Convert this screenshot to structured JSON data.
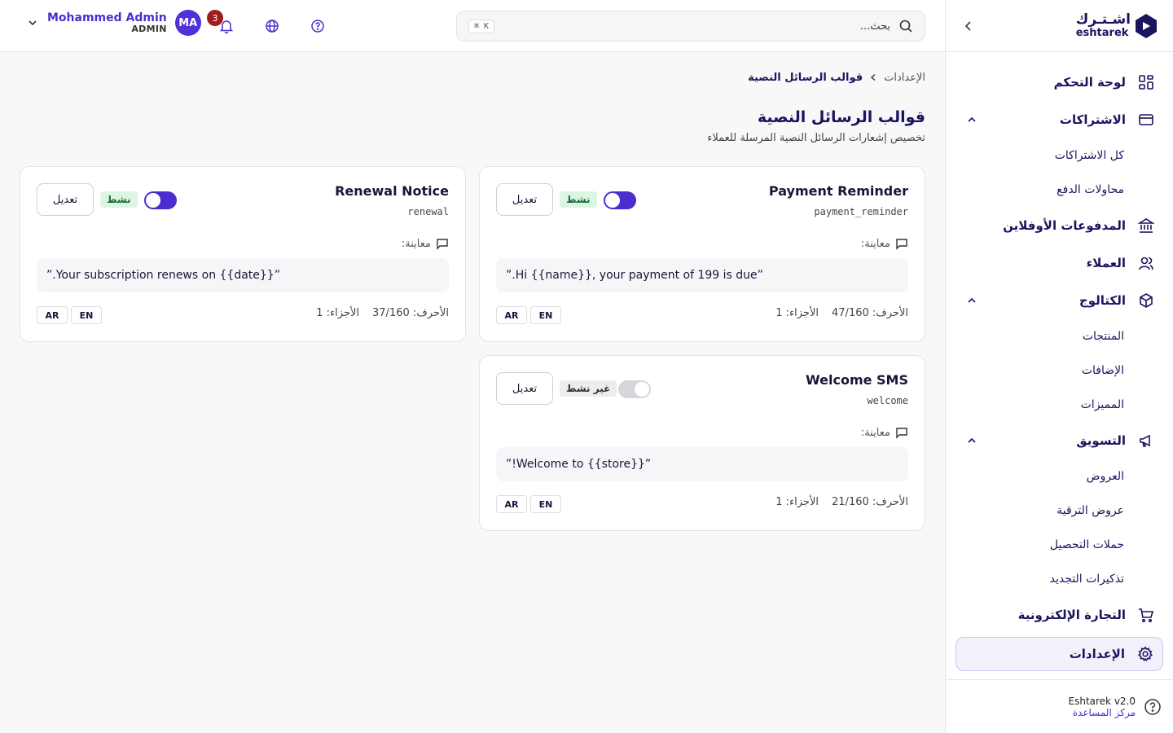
{
  "brand": {
    "name_ar": "اشـتـرك",
    "name_en": "eshtarek"
  },
  "sidebar": {
    "items": [
      {
        "label": "لوحة التحكم",
        "icon": "dashboard-icon"
      },
      {
        "label": "الاشتراكات",
        "icon": "card-icon",
        "expanded": true,
        "children": [
          "كل الاشتراكات",
          "محاولات الدفع"
        ]
      },
      {
        "label": "المدفوعات الأوفلاين",
        "icon": "bank-icon"
      },
      {
        "label": "العملاء",
        "icon": "users-icon"
      },
      {
        "label": "الكتالوج",
        "icon": "box-icon",
        "expanded": true,
        "children": [
          "المنتجات",
          "الإضافات",
          "المميزات"
        ]
      },
      {
        "label": "التسويق",
        "icon": "megaphone-icon",
        "expanded": true,
        "children": [
          "العروض",
          "عروض الترقية",
          "حملات التحصيل",
          "تذكيرات التجديد"
        ]
      },
      {
        "label": "التجارة الإلكترونية",
        "icon": "cart-icon"
      },
      {
        "label": "الإعدادات",
        "icon": "gear-icon",
        "active": true
      }
    ],
    "footer": {
      "version": "Eshtarek v2.0",
      "help": "مركز المساعدة"
    }
  },
  "header": {
    "search_placeholder": "بحث...",
    "search_shortcut": "⌘ K",
    "notifications_count": "3",
    "user": {
      "name": "Mohammed Admin",
      "role": "ADMIN",
      "initials": "MA"
    }
  },
  "page": {
    "breadcrumb": [
      "الإعدادات",
      "قوالب الرسائل النصية"
    ],
    "title": "قوالب الرسائل النصية",
    "subtitle": "تخصيص إشعارات الرسائل النصية المرسلة للعملاء"
  },
  "templates": [
    {
      "title": "Payment Reminder",
      "key": "payment_reminder",
      "active": true,
      "status": "نشط",
      "edit": "تعديل",
      "preview_label": "معاينة:",
      "preview": "”Hi {{name}}, your payment of 199 is due.”",
      "chars": "الأحرف: 47/160",
      "parts": "الأجزاء: 1",
      "langs": [
        "EN",
        "AR"
      ]
    },
    {
      "title": "Renewal Notice",
      "key": "renewal",
      "active": true,
      "status": "نشط",
      "edit": "تعديل",
      "preview_label": "معاينة:",
      "preview": "”Your subscription renews on {{date}}.”",
      "chars": "الأحرف: 37/160",
      "parts": "الأجزاء: 1",
      "langs": [
        "EN",
        "AR"
      ]
    },
    {
      "title": "Welcome SMS",
      "key": "welcome",
      "active": false,
      "status": "غير نشط",
      "edit": "تعديل",
      "preview_label": "معاينة:",
      "preview": "”Welcome to {{store}}!”",
      "chars": "الأحرف: 21/160",
      "parts": "الأجزاء: 1",
      "langs": [
        "EN",
        "AR"
      ]
    }
  ],
  "colors": {
    "accent": "#4a2ccf",
    "brand_navy": "#1a1560",
    "badge_red": "#a11d1d",
    "active_green_bg": "#dcf5e4"
  }
}
